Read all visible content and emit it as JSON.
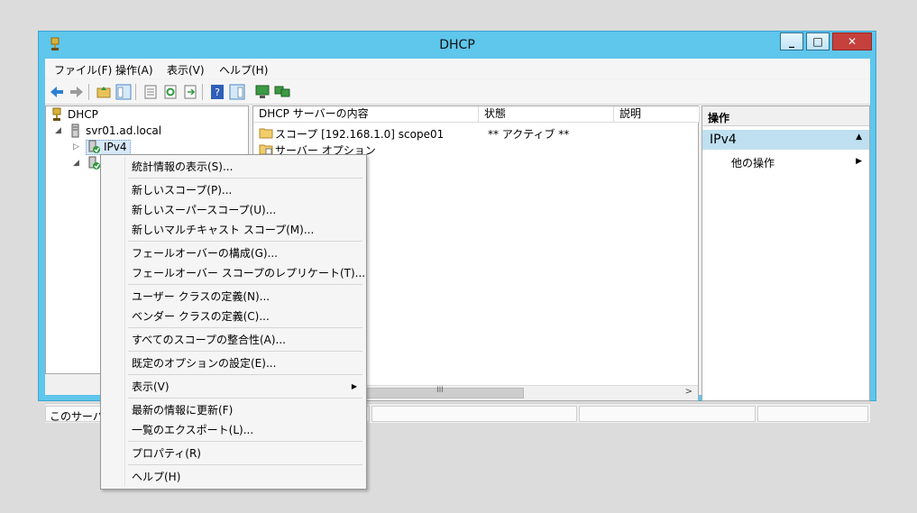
{
  "window": {
    "title": "DHCP"
  },
  "menubar": [
    "ファイル(F)",
    "操作(A)",
    "表示(V)",
    "ヘルプ(H)"
  ],
  "tree": {
    "root": "DHCP",
    "server": "svr01.ad.local",
    "ipv4": "IPv4"
  },
  "list": {
    "columns": [
      "DHCP サーバーの内容",
      "状態",
      "説明"
    ],
    "rows": [
      {
        "name": "スコープ [192.168.1.0] scope01",
        "status": "** アクティブ **"
      },
      {
        "name": "サーバー オプション",
        "status": ""
      }
    ]
  },
  "actions": {
    "header": "操作",
    "section": "IPv4",
    "item": "他の操作"
  },
  "status": {
    "text": "このサーバー"
  },
  "context_menu": [
    {
      "label": "統計情報の表示(S)..."
    },
    {
      "separator": true
    },
    {
      "label": "新しいスコープ(P)..."
    },
    {
      "label": "新しいスーパースコープ(U)..."
    },
    {
      "label": "新しいマルチキャスト スコープ(M)..."
    },
    {
      "separator": true
    },
    {
      "label": "フェールオーバーの構成(G)..."
    },
    {
      "label": "フェールオーバー スコープのレプリケート(T)..."
    },
    {
      "separator": true
    },
    {
      "label": "ユーザー クラスの定義(N)..."
    },
    {
      "label": "ベンダー クラスの定義(C)..."
    },
    {
      "separator": true
    },
    {
      "label": "すべてのスコープの整合性(A)..."
    },
    {
      "separator": true
    },
    {
      "label": "既定のオプションの設定(E)..."
    },
    {
      "separator": true
    },
    {
      "label": "表示(V)",
      "submenu": true
    },
    {
      "separator": true
    },
    {
      "label": "最新の情報に更新(F)"
    },
    {
      "label": "一覧のエクスポート(L)..."
    },
    {
      "separator": true
    },
    {
      "label": "プロパティ(R)"
    },
    {
      "separator": true
    },
    {
      "label": "ヘルプ(H)"
    }
  ],
  "colors": {
    "title_bar": "#5fc6ec",
    "close_button": "#c6403c",
    "action_section": "#bfe0f0"
  }
}
